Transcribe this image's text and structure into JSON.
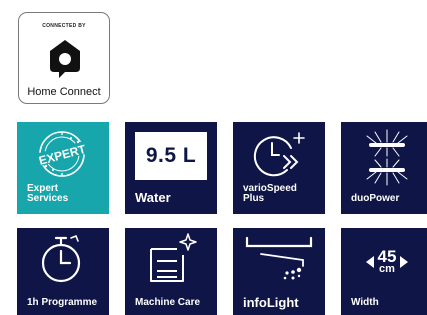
{
  "badge": {
    "caption": "CONNECTED BY",
    "name": "Home Connect",
    "icon": "home-connect-logo"
  },
  "tiles": [
    {
      "id": "expert-services",
      "label": "Expert\nServices",
      "icon": "expert-seal-icon",
      "seal_text": "EXPERT",
      "color": "#17a6ab"
    },
    {
      "id": "water",
      "label": "Water",
      "value": "9.5 L",
      "color": "#0f1547"
    },
    {
      "id": "variospeed-plus",
      "label": "varioSpeed\nPlus",
      "icon": "variospeed-clock-icon",
      "color": "#0f1547"
    },
    {
      "id": "duopower",
      "label": "duoPower",
      "icon": "spray-arms-icon",
      "color": "#0f1547"
    },
    {
      "id": "1h-programme",
      "label": "1h Programme",
      "icon": "stopwatch-icon",
      "color": "#0f1547"
    },
    {
      "id": "machine-care",
      "label": "Machine Care",
      "icon": "sparkling-machine-icon",
      "color": "#0f1547"
    },
    {
      "id": "infolight",
      "label": "infoLight",
      "icon": "floor-light-icon",
      "color": "#0f1547"
    },
    {
      "id": "width",
      "label": "Width",
      "value": "45",
      "unit": "cm",
      "icon": "width-arrows-icon",
      "color": "#0f1547"
    }
  ]
}
